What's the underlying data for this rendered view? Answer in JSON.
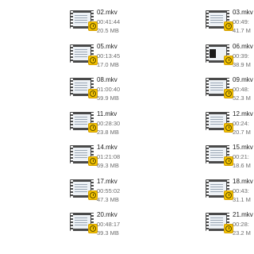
{
  "files": [
    {
      "name": "02.mkv",
      "duration": "00:41:44",
      "size": "20.5 MB",
      "thumb": "doc"
    },
    {
      "name": "03.mkv",
      "duration": "00:49:",
      "size": "41.7 M",
      "thumb": "doc"
    },
    {
      "name": "05.mkv",
      "duration": "00:13:45",
      "size": "17.0 MB",
      "thumb": "doc"
    },
    {
      "name": "06.mkv",
      "duration": "00:39:",
      "size": "38.9 M",
      "thumb": "dark"
    },
    {
      "name": "08.mkv",
      "duration": "01:00:40",
      "size": "59.9 MB",
      "thumb": "doc"
    },
    {
      "name": "09.mkv",
      "duration": "00:48:",
      "size": "52.3 M",
      "thumb": "doc"
    },
    {
      "name": "11.mkv",
      "duration": "00:28:30",
      "size": "23.8 MB",
      "thumb": "doc"
    },
    {
      "name": "12.mkv",
      "duration": "00:24:",
      "size": "20.7 M",
      "thumb": "doc"
    },
    {
      "name": "14.mkv",
      "duration": "01:21:08",
      "size": "69.3 MB",
      "thumb": "doc"
    },
    {
      "name": "15.mkv",
      "duration": "00:21:",
      "size": "18.6 M",
      "thumb": "doc"
    },
    {
      "name": "17.mkv",
      "duration": "00:55:02",
      "size": "47.3 MB",
      "thumb": "doc"
    },
    {
      "name": "18.mkv",
      "duration": "00:43:",
      "size": "31.1 M",
      "thumb": "doc"
    },
    {
      "name": "20.mkv",
      "duration": "00:48:17",
      "size": "39.3 MB",
      "thumb": "doc"
    },
    {
      "name": "21.mkv",
      "duration": "00:28:",
      "size": "23.2 M",
      "thumb": "doc"
    }
  ],
  "icons": {
    "file_icon": "video-file-icon",
    "badge_icon": "media-clock-badge-icon"
  },
  "colors": {
    "film_frame": "#4a4a4a",
    "badge": "#f5c400",
    "name_text": "#1c1c1c",
    "meta_text": "#6d6d6d"
  }
}
